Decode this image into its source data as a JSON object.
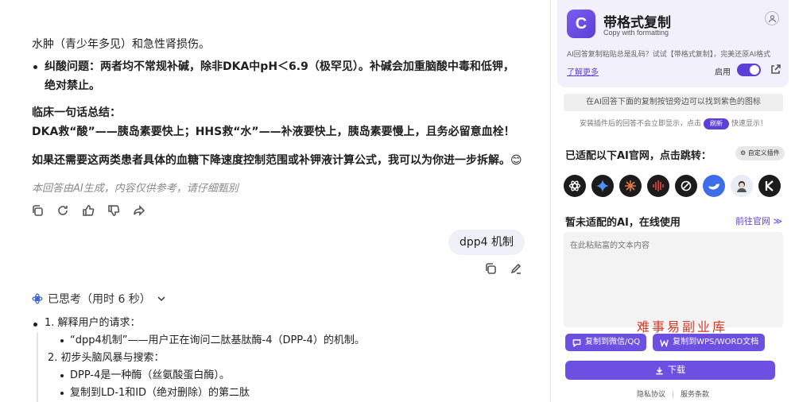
{
  "chat": {
    "para1": "水肿（青少年多见）和急性肾损伤。",
    "bullet1": "纠酸问题：两者均不常规补碱，除非DKA中pH＜6.9（极罕见）。补碱会加重脑酸中毒和低钾，绝对禁止。",
    "summary_title": "临床一句话总结：",
    "summary_line": "DKA救“酸”——胰岛素要快上；HHS救“水”——补液要快上，胰岛素要慢上，且务必留意血栓！",
    "followup": "如果还需要这两类患者具体的血糖下降速度控制范围或补钾液计算公式，我可以为你进一步拆解。😊",
    "disclaimer": "本回答由AI生成，内容仅供参考，请仔细甄别",
    "user_message": "dpp4 机制",
    "thought_label": "已思考（用时 6 秒）",
    "steps": [
      {
        "title": "1. 解释用户的请求：",
        "items": [
          "“dpp4机制”——用户正在询问二肽基肽酶-4（DPP-4）的机制。"
        ]
      },
      {
        "title": "2. 初步头脑风暴与搜索：",
        "items": [
          "DPP-4是一种酶（丝氨酸蛋白酶）。",
          "复制到LD-1和ID（绝对删除）的第二肽"
        ]
      }
    ]
  },
  "sidebar": {
    "brand_title": "带格式复制",
    "brand_subtitle": "Copy with formatting",
    "description": "AI回答复制粘贴总是乱码？试试【带格式复制】，完美还原AI格式",
    "learn_more": "了解更多",
    "enable_label": "启用",
    "tip1": "在AI回答下面的复制按钮旁边可以找到紫色的图标",
    "tip2_before": "安装插件后的回答不会立即显示，点击",
    "tip2_pill": "刷新",
    "tip2_after": "快速显示！",
    "adapted_title": "已适配以下AI官网，点击跳转：",
    "custom_button": "自定义插件",
    "ai_icons": [
      "chatgpt-icon",
      "gemini-icon",
      "claude-icon",
      "doubao-icon",
      "perplexity-icon",
      "deepseek-icon",
      "avatar-ai-icon",
      "kimi-icon"
    ],
    "unadapted_title": "暂未适配的AI，在线使用",
    "goto_official": "前往官网 ≫",
    "textarea_placeholder": "在此粘贴富的文本内容",
    "watermark": "难事易副业库",
    "copy_wechat": "复制到微信/QQ",
    "copy_wps": "复制到WPS/WORD文档",
    "download": "下载",
    "footer_privacy": "隐私协议",
    "footer_terms": "服务条款"
  },
  "colors": {
    "accent": "#5b3fd6",
    "button": "#6d4fe2",
    "bubble": "#eef1f8",
    "watermark": "#d23a2a"
  }
}
